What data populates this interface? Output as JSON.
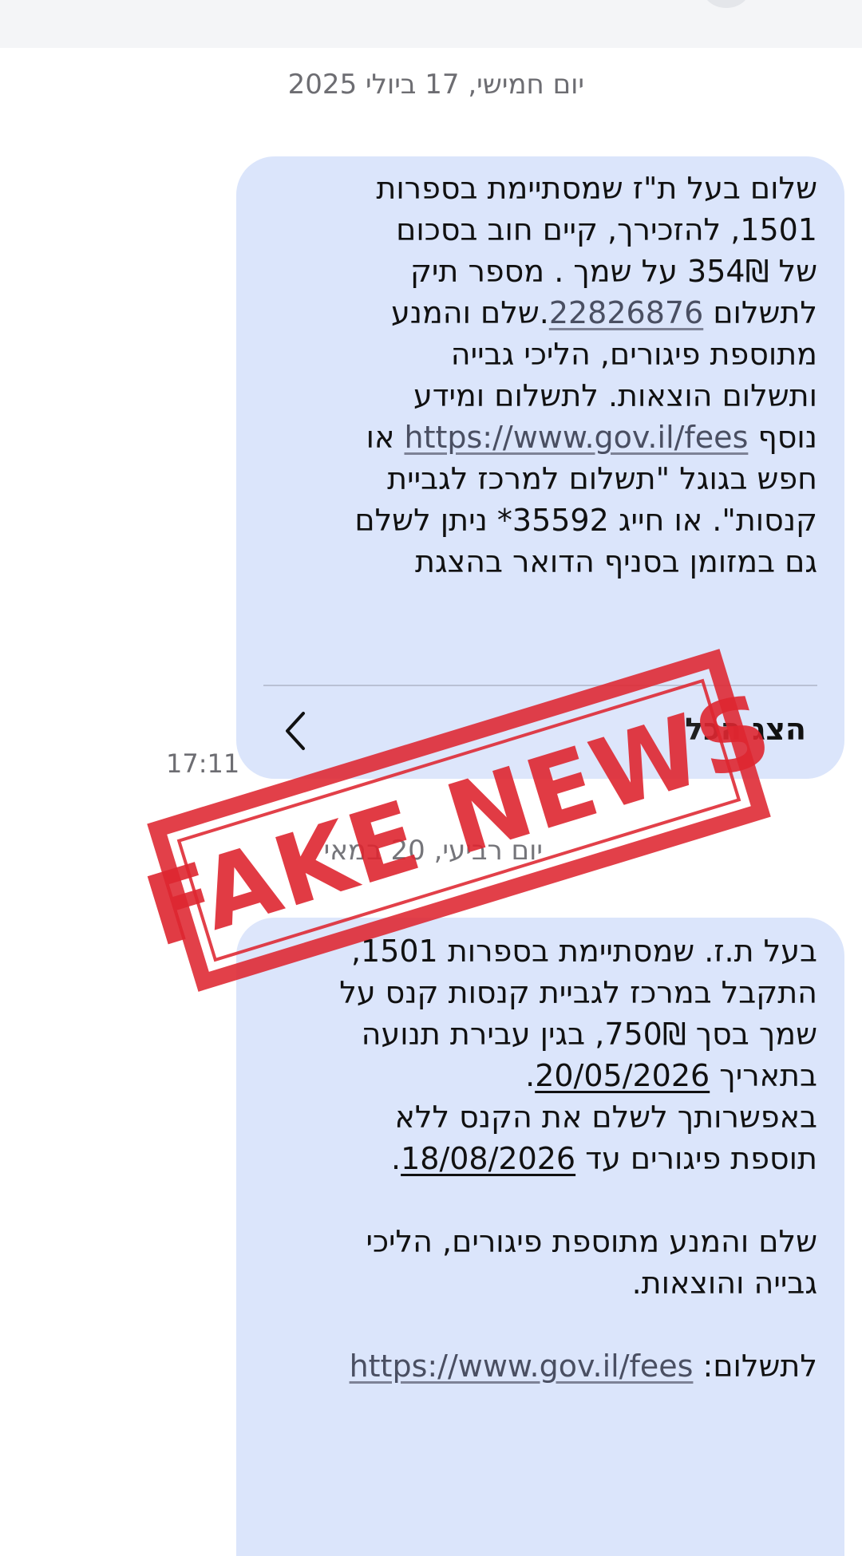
{
  "conversation": {
    "date_separators": [
      "יום חמישי, 17 ביולי 2025",
      "יום רביעי, 20 במאי"
    ]
  },
  "message1": {
    "lines": [
      [
        "שלום בעל ת\"ז שמסתיימת בספרות"
      ],
      [
        "1501,    להזכירך, קיים חוב בסכום"
      ],
      [
        "של  354₪ על שמך .     מספר תיק"
      ],
      [
        "לתשלום ",
        "22826876",
        ".שלם והמנע"
      ],
      [
        "מתוספת פיגורים, הליכי גבייה"
      ],
      [
        "ותשלום הוצאות.  לתשלום ומידע"
      ],
      [
        "נוסף ",
        "https://www.gov.il/fees",
        "  או"
      ],
      [
        "חפש בגוגל \"תשלום למרכז לגביית"
      ],
      [
        "קנסות\". או חייג 35592*  ניתן לשלם"
      ],
      [
        "גם במזומן בסניף הדואר בהצגת"
      ]
    ],
    "show_all_label": "הצג הכל",
    "time": "17:11"
  },
  "message2": {
    "lines": [
      [
        "בעל ת.ז. שמסתיימת בספרות 1501,"
      ],
      [
        "התקבל במרכז לגביית קנסות קנס על"
      ],
      [
        "שמך בסך 750₪, בגין עבירת תנועה"
      ],
      [
        "בתאריך ",
        "20/05/2026",
        "."
      ],
      [
        "באפשרותך לשלם את הקנס ללא"
      ],
      [
        "תוספת פיגורים עד ",
        "18/08/2026",
        "."
      ],
      [
        ""
      ],
      [
        "שלם והמנע מתוספת פיגורים, הליכי"
      ],
      [
        "גבייה והוצאות."
      ],
      [
        ""
      ],
      [
        "לתשלום: ",
        "https://www.gov.il/fees"
      ]
    ]
  },
  "stamp": {
    "text": "FAKE NEWS",
    "color": "#de2630"
  },
  "colors": {
    "bubble": "#dbe5fb",
    "meta_text": "#6d6d72",
    "link": "#4a4f62"
  },
  "icons": {
    "chevron": "chevron-left-icon"
  }
}
